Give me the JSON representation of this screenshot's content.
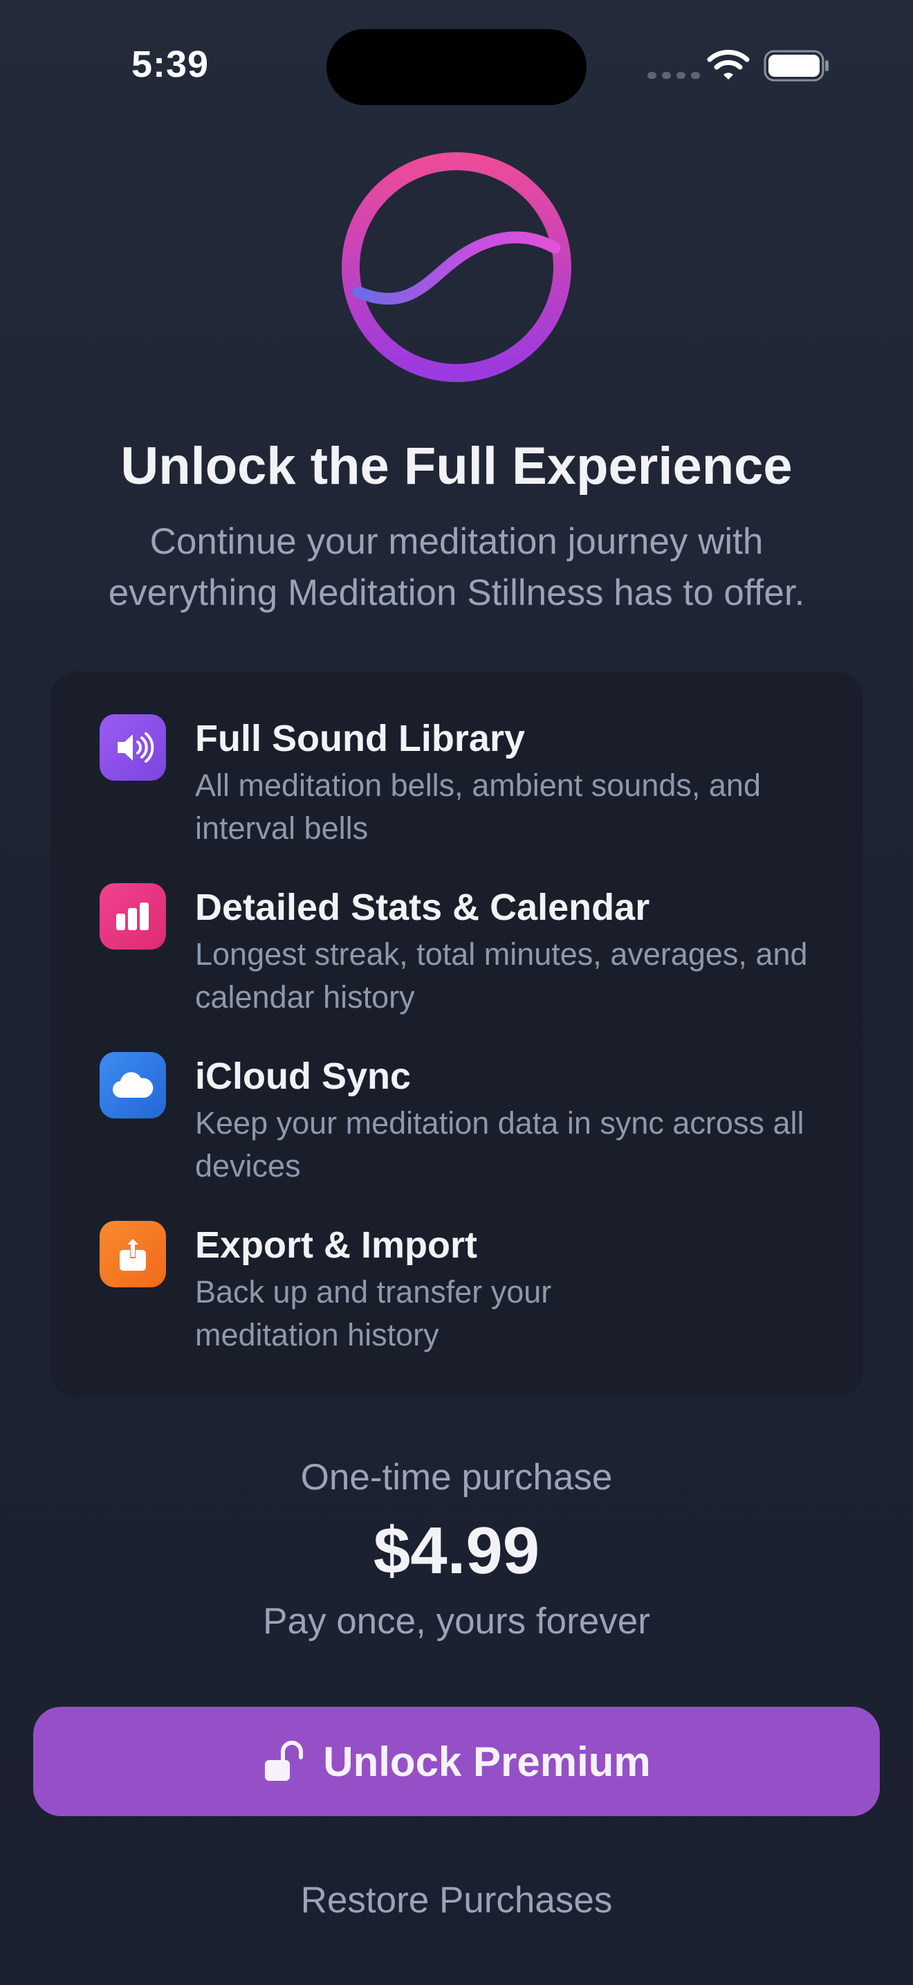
{
  "status_bar": {
    "time": "5:39"
  },
  "hero": {
    "title": "Unlock the Full Experience",
    "subtitle": "Continue your meditation journey with everything Meditation Stillness has to offer."
  },
  "features": [
    {
      "title": "Full Sound Library",
      "description": "All meditation bells, ambient sounds, and interval bells",
      "icon": "speaker-wave-icon",
      "color": "#8a4fe8"
    },
    {
      "title": "Detailed Stats & Calendar",
      "description": "Longest streak, total minutes, averages, and calendar history",
      "icon": "bar-chart-icon",
      "color": "#e8337f"
    },
    {
      "title": "iCloud Sync",
      "description": "Keep your meditation data in sync across all devices",
      "icon": "cloud-icon",
      "color": "#2f78e4"
    },
    {
      "title": "Export & Import",
      "description": "Back up and transfer your meditation history",
      "icon": "share-icon",
      "color": "#f47a22"
    }
  ],
  "pricing": {
    "caption": "One-time purchase",
    "price": "$4.99",
    "note": "Pay once, yours forever"
  },
  "actions": {
    "unlock_label": "Unlock Premium",
    "unlock_icon": "lock-open-icon",
    "restore_label": "Restore Purchases"
  },
  "colors": {
    "accent": "#9550c8",
    "background": "#1f2433",
    "card": "#1a1e2b",
    "secondary_text": "#9aa3b7"
  }
}
